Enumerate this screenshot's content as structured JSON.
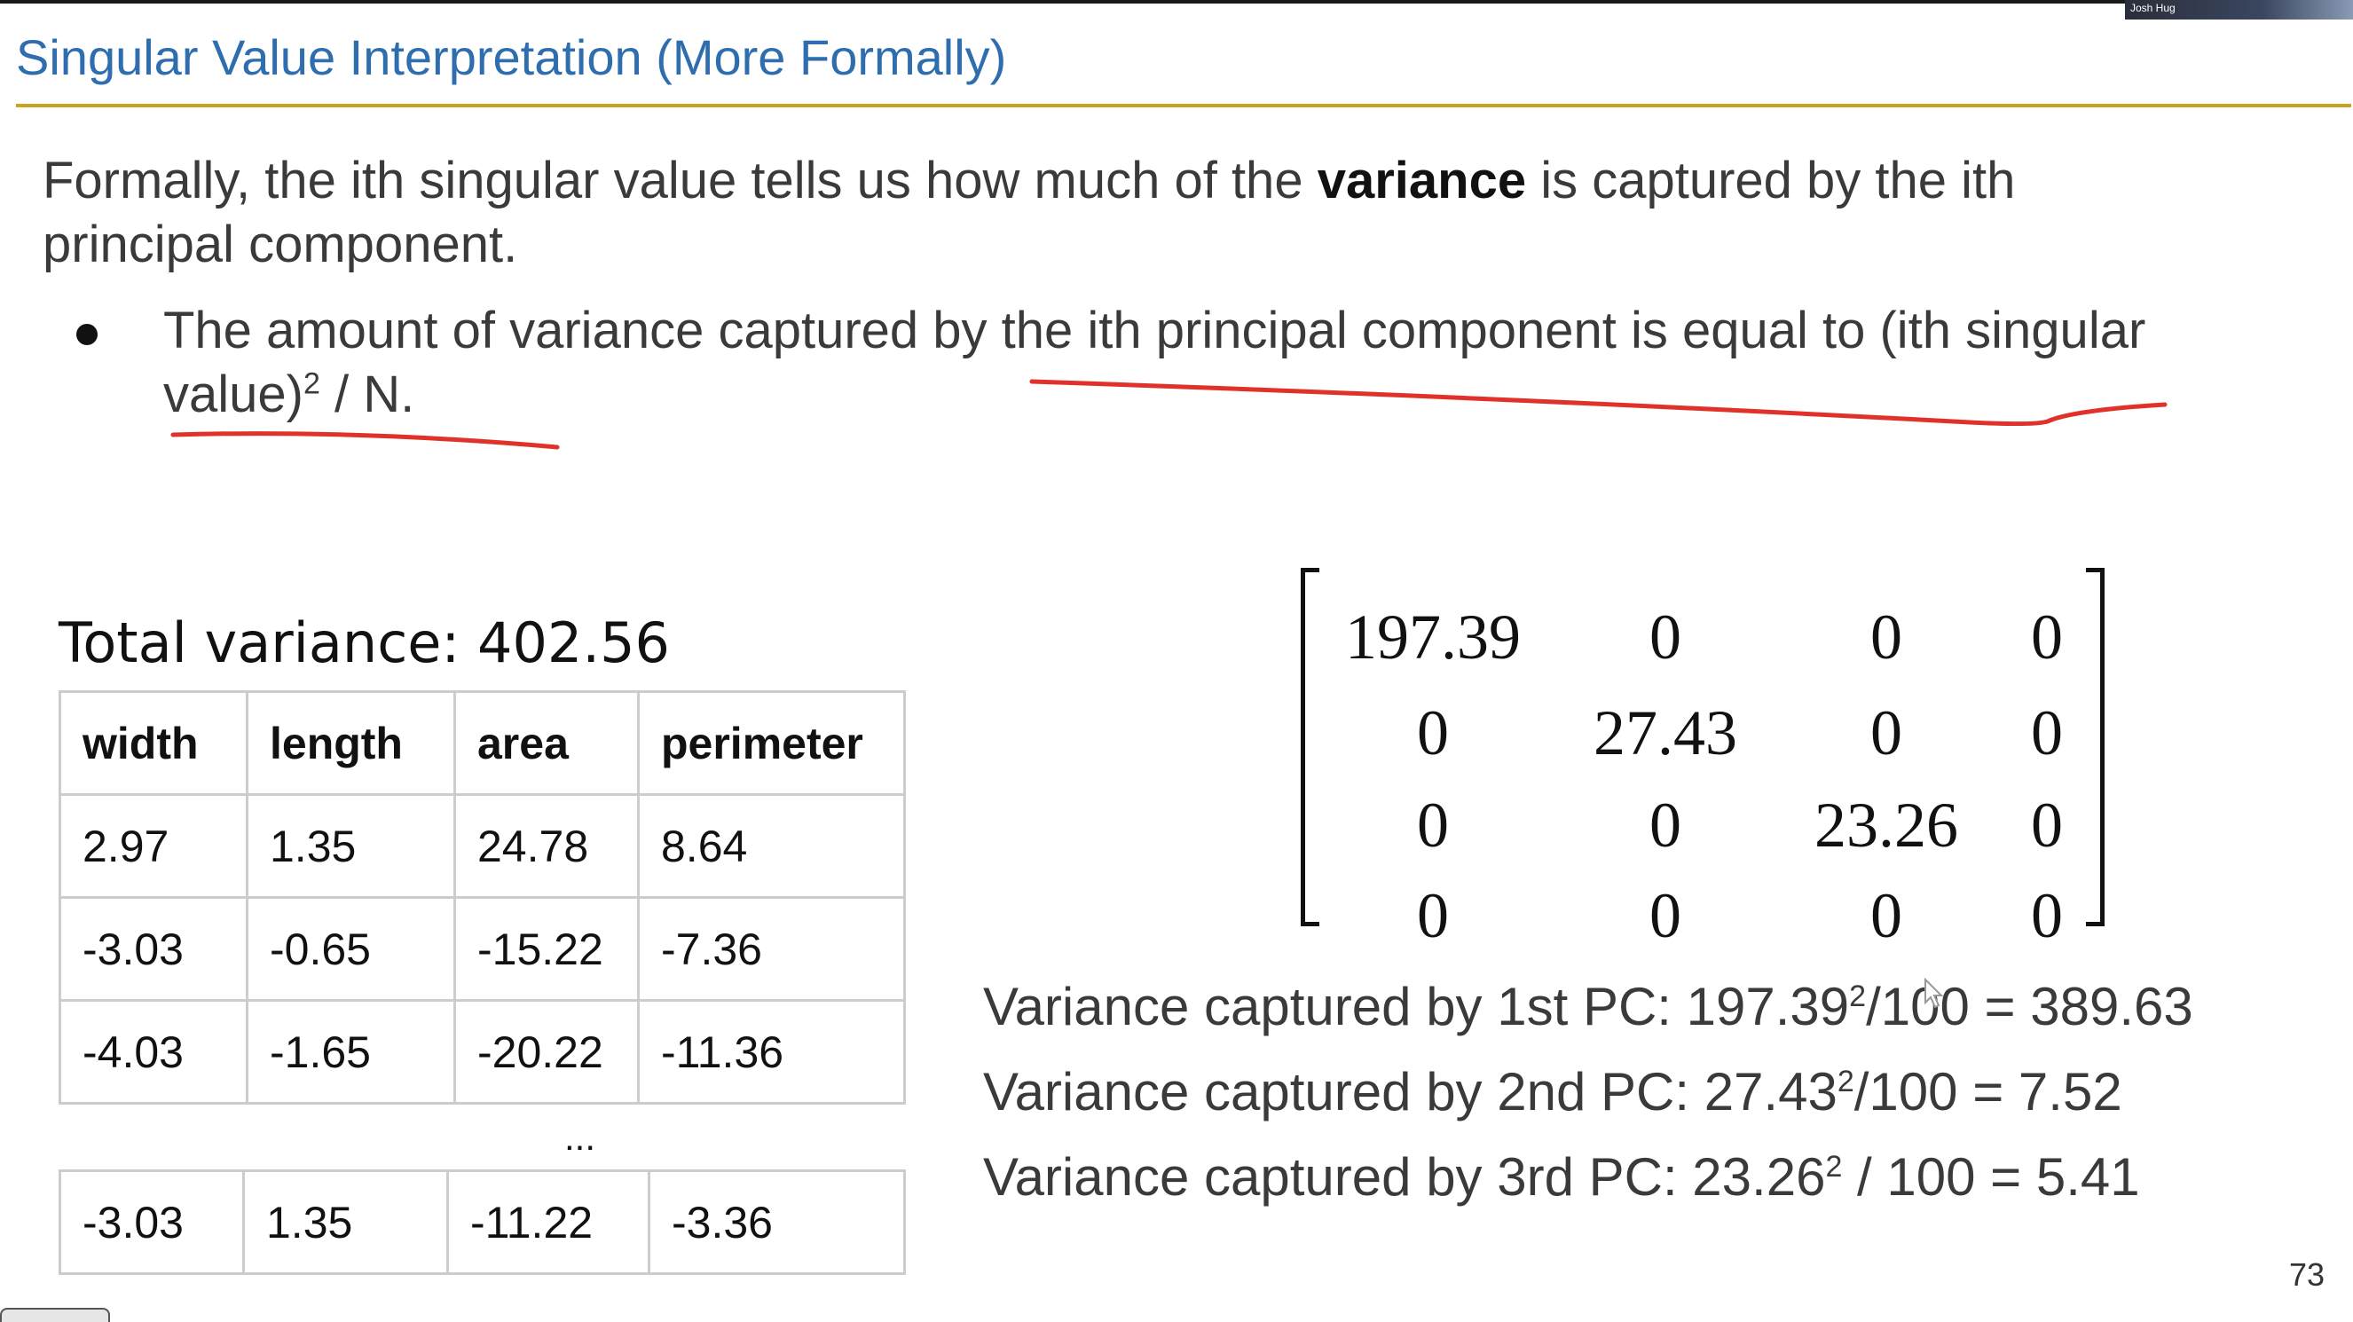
{
  "slide": {
    "title": "Singular Value Interpretation (More Formally)",
    "webcam_label": "Josh Hug",
    "page_number": "73"
  },
  "intro": {
    "part1": "Formally, the ith singular value tells us how much of the ",
    "bold": "variance",
    "part2": " is captured by the ith principal component."
  },
  "bullet": {
    "text_before_sup": "The amount of variance captured by the ith principal component is equal to (ith singular value)",
    "sup": "2",
    "text_after_sup": " / N."
  },
  "total_variance": "Total variance: 402.56",
  "table": {
    "headers": [
      "width",
      "length",
      "area",
      "perimeter"
    ],
    "rows": [
      [
        "2.97",
        "1.35",
        "24.78",
        "8.64"
      ],
      [
        "-3.03",
        "-0.65",
        "-15.22",
        "-7.36"
      ],
      [
        "-4.03",
        "-1.65",
        "-20.22",
        "-11.36"
      ]
    ],
    "ellipsis": "...",
    "last_row": [
      "-3.03",
      "1.35",
      "-11.22",
      "-3.36"
    ]
  },
  "matrix": {
    "rows": [
      [
        "197.39",
        "0",
        "0",
        "0"
      ],
      [
        "0",
        "27.43",
        "0",
        "0"
      ],
      [
        "0",
        "0",
        "23.26",
        "0"
      ],
      [
        "0",
        "0",
        "0",
        "0"
      ]
    ]
  },
  "variance_lines": [
    {
      "prefix": "Variance captured by 1st PC: 197.39",
      "sup": "2",
      "suffix": "/100 = 389.63"
    },
    {
      "prefix": "Variance captured by 2nd PC: 27.43",
      "sup": "2",
      "suffix": "/100 = 7.52"
    },
    {
      "prefix": "Variance captured by 3rd PC: 23.26",
      "sup": "2",
      "suffix": " / 100 = 5.41"
    }
  ],
  "colors": {
    "title": "#2f6eae",
    "title_rule": "#c9a21e",
    "annotation": "#e0322a"
  }
}
